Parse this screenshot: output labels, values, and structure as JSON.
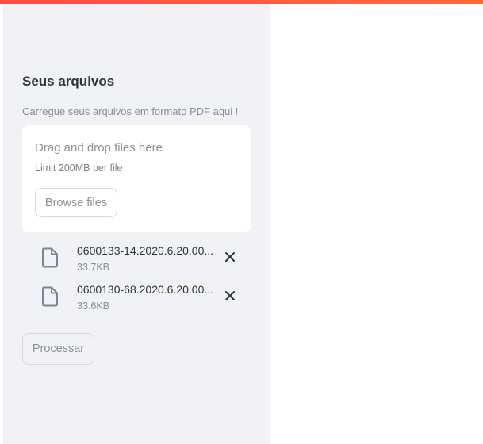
{
  "sidebar": {
    "heading": "Seus arquivos",
    "caption": "Carregue seus arquivos em formato PDF aqui !",
    "uploader": {
      "drop_text": "Drag and drop files here",
      "limit_text": "Limit 200MB per file",
      "browse_label": "Browse files"
    },
    "files": [
      {
        "name": "0600133-14.2020.6.20.00...",
        "size": "33.7KB",
        "icon": "file-icon",
        "remove_icon": "close-icon"
      },
      {
        "name": "0600130-68.2020.6.20.00...",
        "size": "33.6KB",
        "icon": "file-icon",
        "remove_icon": "close-icon"
      }
    ],
    "process_label": "Processar"
  },
  "colors": {
    "accent": "#ff4b4b",
    "sidebar_bg": "#f0f2f6",
    "text": "#31333f",
    "muted": "#8d919b"
  }
}
